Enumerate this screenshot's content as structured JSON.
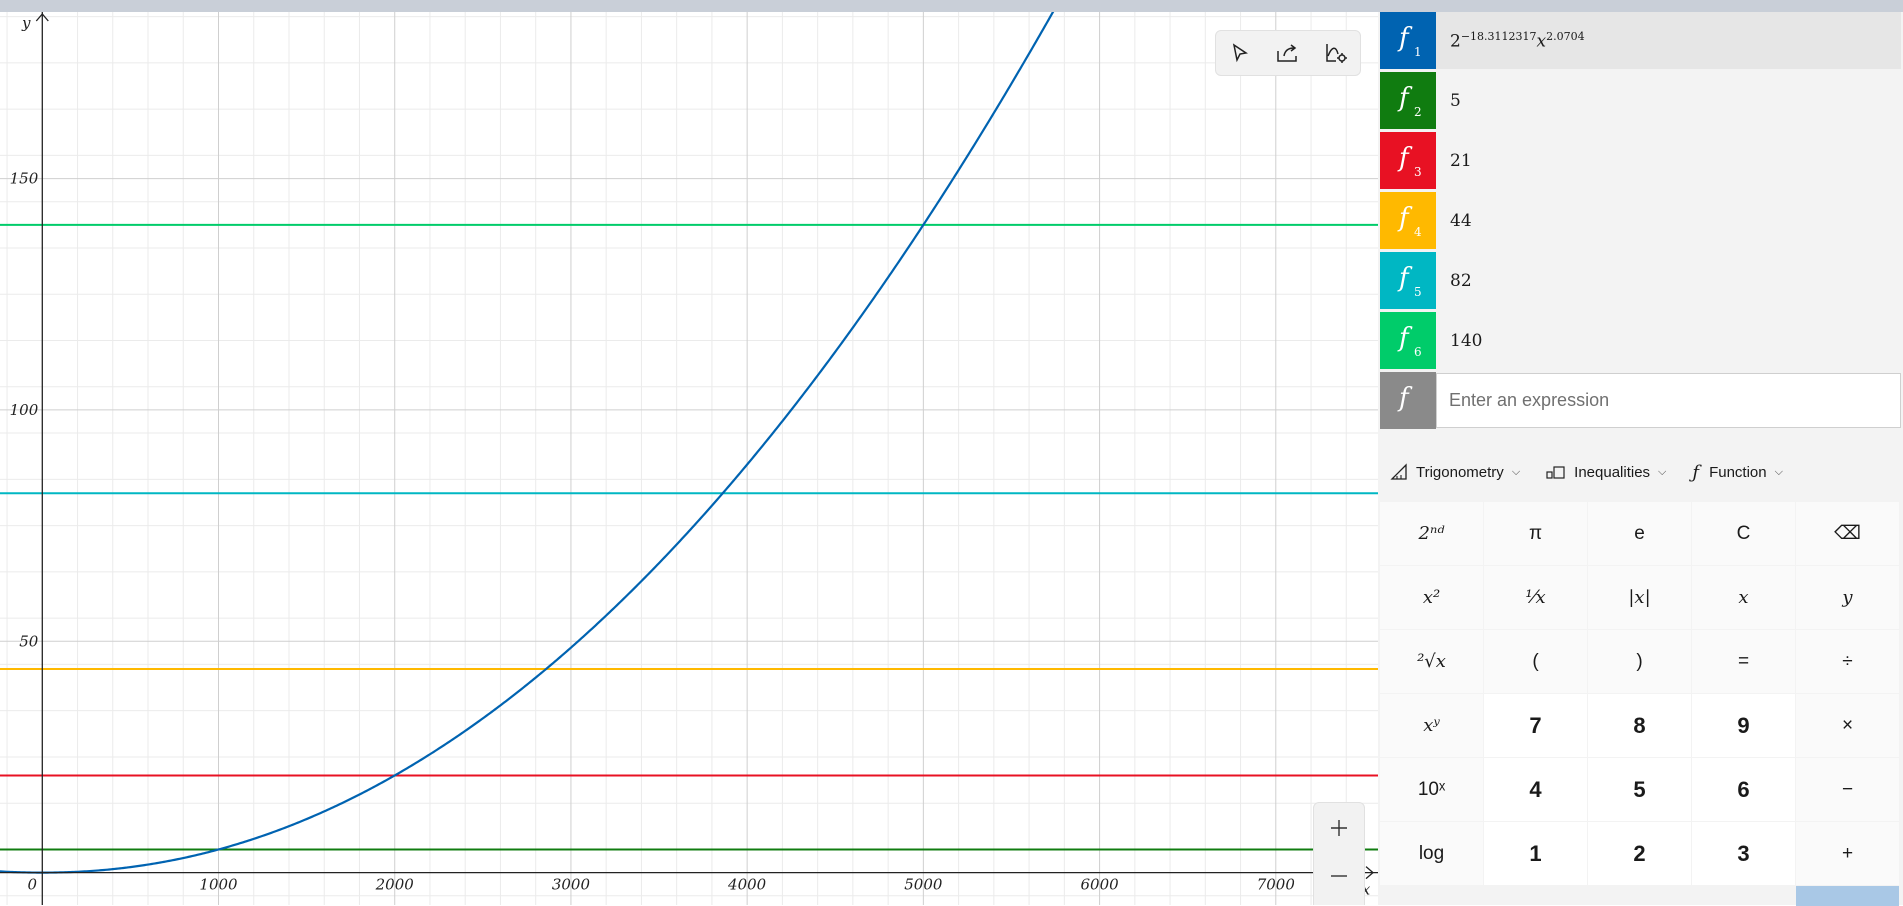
{
  "functions": [
    {
      "label": "f",
      "index": "1",
      "color": "#0063b1",
      "expr_base": "2",
      "expr_exp1": "−18.3112317",
      "expr_var": "x",
      "expr_exp2": "2.0704"
    },
    {
      "label": "f",
      "index": "2",
      "color": "#107c10",
      "value": "5"
    },
    {
      "label": "f",
      "index": "3",
      "color": "#e81123",
      "value": "21"
    },
    {
      "label": "f",
      "index": "4",
      "color": "#ffb900",
      "value": "44"
    },
    {
      "label": "f",
      "index": "5",
      "color": "#00b7c3",
      "value": "82"
    },
    {
      "label": "f",
      "index": "6",
      "color": "#00cc6a",
      "value": "140"
    }
  ],
  "new_function": {
    "label": "f",
    "color": "#8a8a8a",
    "placeholder": "Enter an expression"
  },
  "categories": [
    {
      "label": "Trigonometry",
      "icon": "triangle-ruler-icon"
    },
    {
      "label": "Inequalities",
      "icon": "inequality-icon"
    },
    {
      "label": "Function",
      "icon": "function-icon"
    }
  ],
  "keypad": [
    [
      "2ⁿᵈ",
      "π",
      "e",
      "C",
      "⌫"
    ],
    [
      "x²",
      "¹⁄x",
      "|x|",
      "x",
      "y"
    ],
    [
      "²√x",
      "(",
      ")",
      "=",
      "÷"
    ],
    [
      "xʸ",
      "7",
      "8",
      "9",
      "×"
    ],
    [
      "10ˣ",
      "4",
      "5",
      "6",
      "−"
    ],
    [
      "log",
      "1",
      "2",
      "3",
      "+"
    ]
  ],
  "graph": {
    "x_axis_label": "x",
    "y_axis_label": "y",
    "x_ticks": [
      "0",
      "1000",
      "2000",
      "3000",
      "4000",
      "5000",
      "6000",
      "7000"
    ],
    "y_ticks": [
      "50",
      "100",
      "150"
    ],
    "x_range": [
      -240,
      7580
    ],
    "y_range": [
      -7,
      186
    ]
  },
  "graph_tools": [
    "select-icon",
    "share-icon",
    "graph-settings-icon"
  ],
  "zoom": {
    "in": "+",
    "out": "−"
  }
}
